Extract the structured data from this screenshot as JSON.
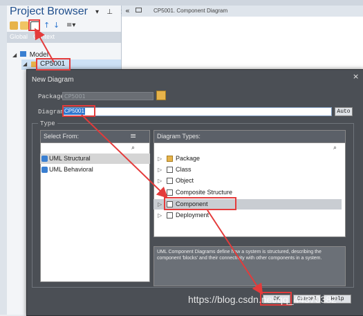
{
  "project_browser": {
    "title": "Project Browser",
    "controls": "▾ ⊥ ×",
    "tabs": [
      "Global",
      "Context"
    ],
    "tree": {
      "model_label": "Model",
      "package_label": "CP5001"
    }
  },
  "document_tab": {
    "arrows": "«",
    "label": "CP5001. Component Diagram"
  },
  "dialog": {
    "title": "New Diagram",
    "close": "×",
    "package_label": "Package",
    "package_value": "CP5001",
    "diagram_label": "Diagram",
    "diagram_value": "CP5001",
    "auto_button": "Auto",
    "type_label": "Type",
    "select_from": {
      "title": "Select From:",
      "items": [
        "UML Structural",
        "UML Behavioral"
      ]
    },
    "diagram_types": {
      "title": "Diagram Types:",
      "items": [
        "Package",
        "Class",
        "Object",
        "Composite Structure",
        "Component",
        "Deployment"
      ]
    },
    "description": "UML Component Diagrams define how a system is structured, describing the component 'blocks' and their connectivity with other components in a system.",
    "buttons": {
      "ok": "OK",
      "cancel": "Cancel",
      "help": "Help"
    }
  },
  "watermark": "https://blog.csdn.net/qq_44370382",
  "colors": {
    "highlight": "#e43b3b",
    "selection": "#2f78d0",
    "dialog_bg": "#4b4f55"
  }
}
